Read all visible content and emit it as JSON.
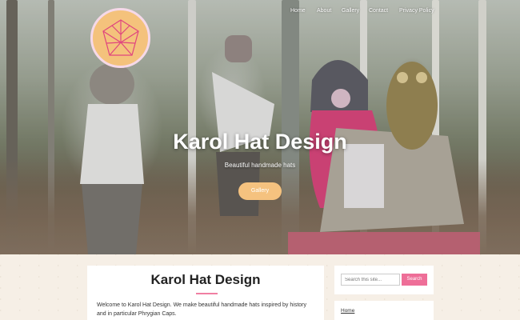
{
  "site": {
    "title": "Karol Hat Design",
    "tagline": "Beautiful handmade hats"
  },
  "nav": {
    "items": [
      "Home",
      "About",
      "Gallery",
      "Contact",
      "Privacy Policy"
    ]
  },
  "hero": {
    "button_label": "Gallery"
  },
  "main": {
    "title": "Karol Hat Design",
    "intro": "Welcome to Karol Hat Design. We make beautiful handmade hats inspired by history and in particular Phrygian Caps."
  },
  "sidebar": {
    "search_placeholder": "Search this site...",
    "search_button": "Search",
    "menu_items": [
      "Home"
    ]
  },
  "colors": {
    "accent_pink": "#ee6e98",
    "accent_orange": "#f5c27f",
    "background": "#f6efe6"
  },
  "icons": {
    "logo": "geometric-crown-logo"
  }
}
